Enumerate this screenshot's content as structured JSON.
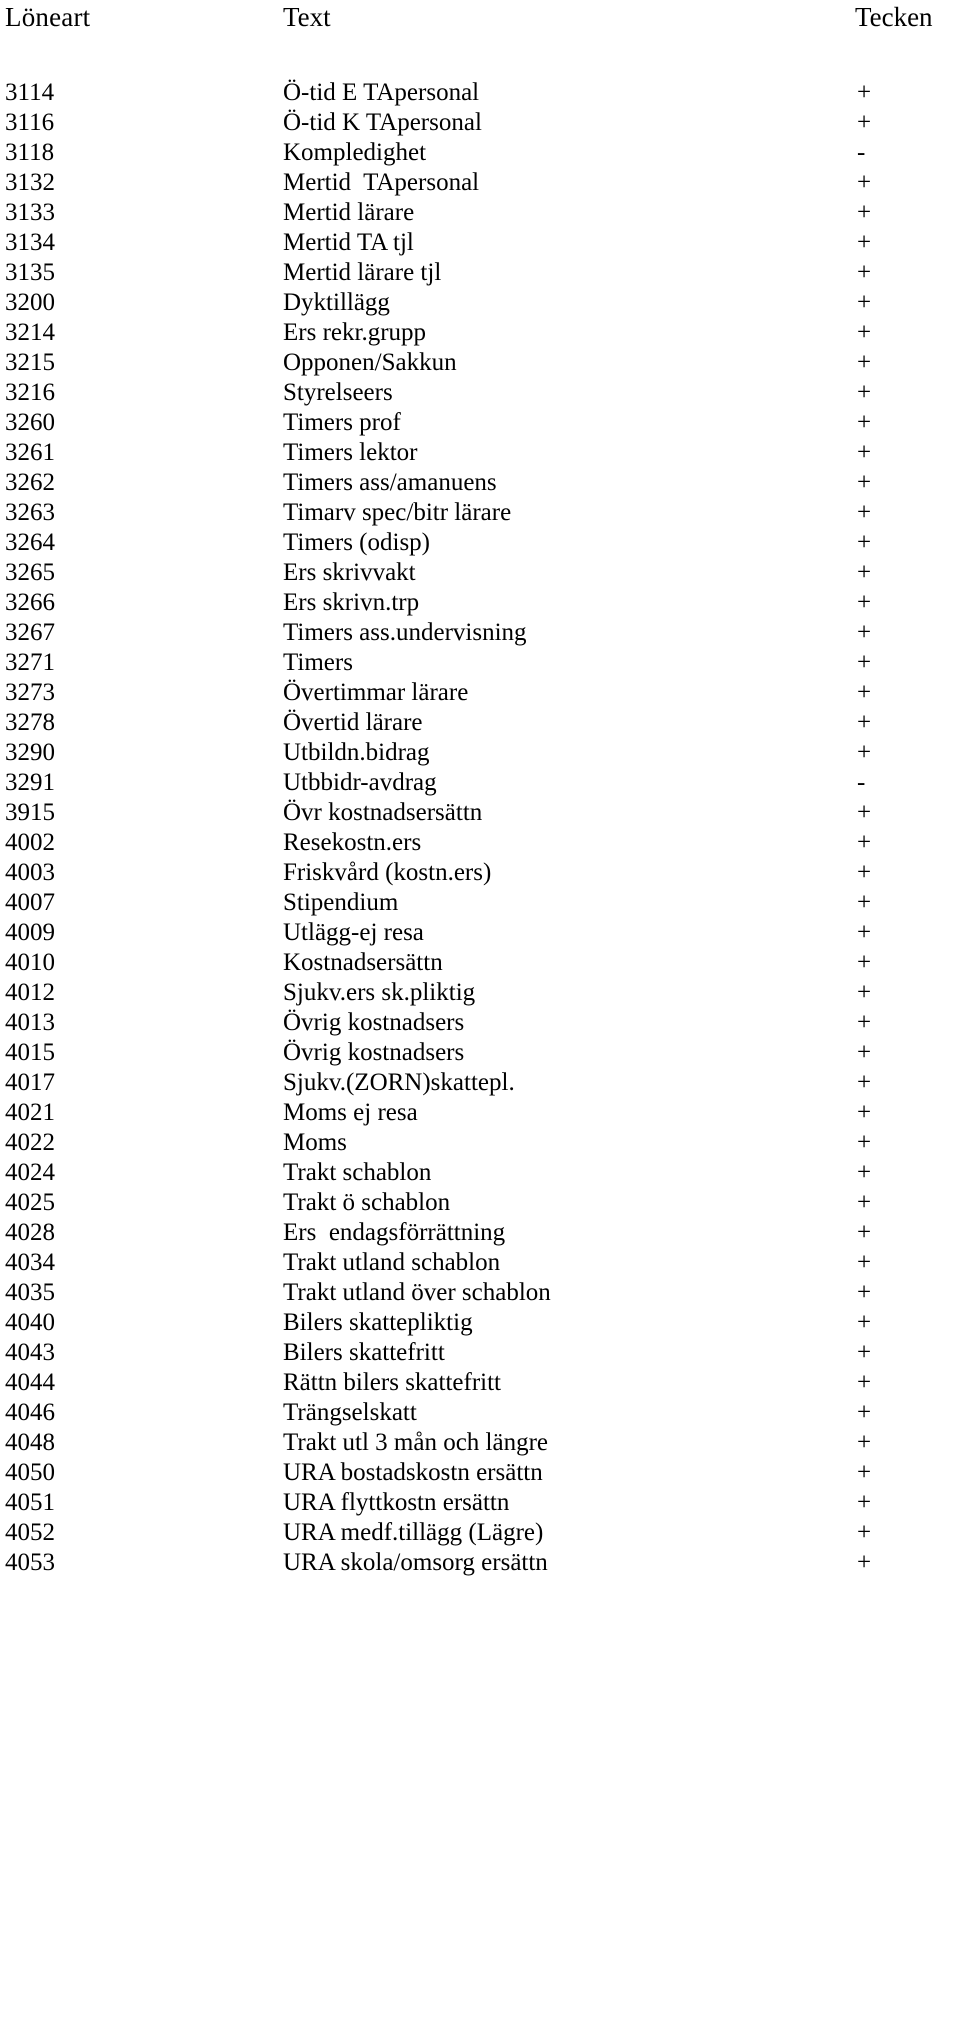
{
  "table": {
    "columns": {
      "code": "Löneart",
      "text": "Text",
      "sign": "Tecken"
    },
    "rows": [
      {
        "code": "3114",
        "text": "Ö-tid E TApersonal",
        "sign": "+"
      },
      {
        "code": "3116",
        "text": "Ö-tid K TApersonal",
        "sign": "+"
      },
      {
        "code": "3118",
        "text": "Kompledighet",
        "sign": "-"
      },
      {
        "code": "3132",
        "text": "Mertid  TApersonal",
        "sign": "+"
      },
      {
        "code": "3133",
        "text": "Mertid lärare",
        "sign": "+"
      },
      {
        "code": "3134",
        "text": "Mertid TA tjl",
        "sign": "+"
      },
      {
        "code": "3135",
        "text": "Mertid lärare tjl",
        "sign": "+"
      },
      {
        "code": "3200",
        "text": "Dyktillägg",
        "sign": "+"
      },
      {
        "code": "3214",
        "text": "Ers rekr.grupp",
        "sign": "+"
      },
      {
        "code": "3215",
        "text": "Opponen/Sakkun",
        "sign": "+"
      },
      {
        "code": "3216",
        "text": "Styrelseers",
        "sign": "+"
      },
      {
        "code": "3260",
        "text": "Timers prof",
        "sign": "+"
      },
      {
        "code": "3261",
        "text": "Timers lektor",
        "sign": "+"
      },
      {
        "code": "3262",
        "text": "Timers ass/amanuens",
        "sign": "+"
      },
      {
        "code": "3263",
        "text": "Timarv spec/bitr lärare",
        "sign": "+"
      },
      {
        "code": "3264",
        "text": "Timers (odisp)",
        "sign": "+"
      },
      {
        "code": "3265",
        "text": "Ers skrivvakt",
        "sign": "+"
      },
      {
        "code": "3266",
        "text": "Ers skrivn.trp",
        "sign": "+"
      },
      {
        "code": "3267",
        "text": "Timers ass.undervisning",
        "sign": "+"
      },
      {
        "code": "3271",
        "text": "Timers",
        "sign": "+"
      },
      {
        "code": "3273",
        "text": "Övertimmar lärare",
        "sign": "+"
      },
      {
        "code": "3278",
        "text": "Övertid lärare",
        "sign": "+"
      },
      {
        "code": "3290",
        "text": "Utbildn.bidrag",
        "sign": "+"
      },
      {
        "code": "3291",
        "text": "Utbbidr-avdrag",
        "sign": "-"
      },
      {
        "code": "3915",
        "text": "Övr kostnadsersättn",
        "sign": "+"
      },
      {
        "code": "4002",
        "text": "Resekostn.ers",
        "sign": "+"
      },
      {
        "code": "4003",
        "text": "Friskvård (kostn.ers)",
        "sign": "+"
      },
      {
        "code": "4007",
        "text": "Stipendium",
        "sign": "+"
      },
      {
        "code": "4009",
        "text": "Utlägg-ej resa",
        "sign": "+"
      },
      {
        "code": "4010",
        "text": "Kostnadsersättn",
        "sign": "+"
      },
      {
        "code": "4012",
        "text": "Sjukv.ers sk.pliktig",
        "sign": "+"
      },
      {
        "code": "4013",
        "text": "Övrig kostnadsers",
        "sign": "+"
      },
      {
        "code": "4015",
        "text": "Övrig kostnadsers",
        "sign": "+"
      },
      {
        "code": "4017",
        "text": "Sjukv.(ZORN)skattepl.",
        "sign": "+"
      },
      {
        "code": "4021",
        "text": "Moms ej resa",
        "sign": "+"
      },
      {
        "code": "4022",
        "text": "Moms",
        "sign": "+"
      },
      {
        "code": "4024",
        "text": "Trakt schablon",
        "sign": "+"
      },
      {
        "code": "4025",
        "text": "Trakt ö schablon",
        "sign": "+"
      },
      {
        "code": "4028",
        "text": "Ers  endagsförrättning",
        "sign": "+"
      },
      {
        "code": "4034",
        "text": "Trakt utland schablon",
        "sign": "+"
      },
      {
        "code": "4035",
        "text": "Trakt utland över schablon",
        "sign": "+"
      },
      {
        "code": "4040",
        "text": "Bilers skattepliktig",
        "sign": "+"
      },
      {
        "code": "4043",
        "text": "Bilers skattefritt",
        "sign": "+"
      },
      {
        "code": "4044",
        "text": "Rättn bilers skattefritt",
        "sign": "+"
      },
      {
        "code": "4046",
        "text": "Trängselskatt",
        "sign": "+"
      },
      {
        "code": "4048",
        "text": "Trakt utl 3 mån och längre",
        "sign": "+"
      },
      {
        "code": "4050",
        "text": "URA bostadskostn ersättn",
        "sign": "+"
      },
      {
        "code": "4051",
        "text": "URA flyttkostn ersättn",
        "sign": "+"
      },
      {
        "code": "4052",
        "text": "URA medf.tillägg (Lägre)",
        "sign": "+"
      },
      {
        "code": "4053",
        "text": "URA skola/omsorg ersättn",
        "sign": "+"
      }
    ]
  }
}
